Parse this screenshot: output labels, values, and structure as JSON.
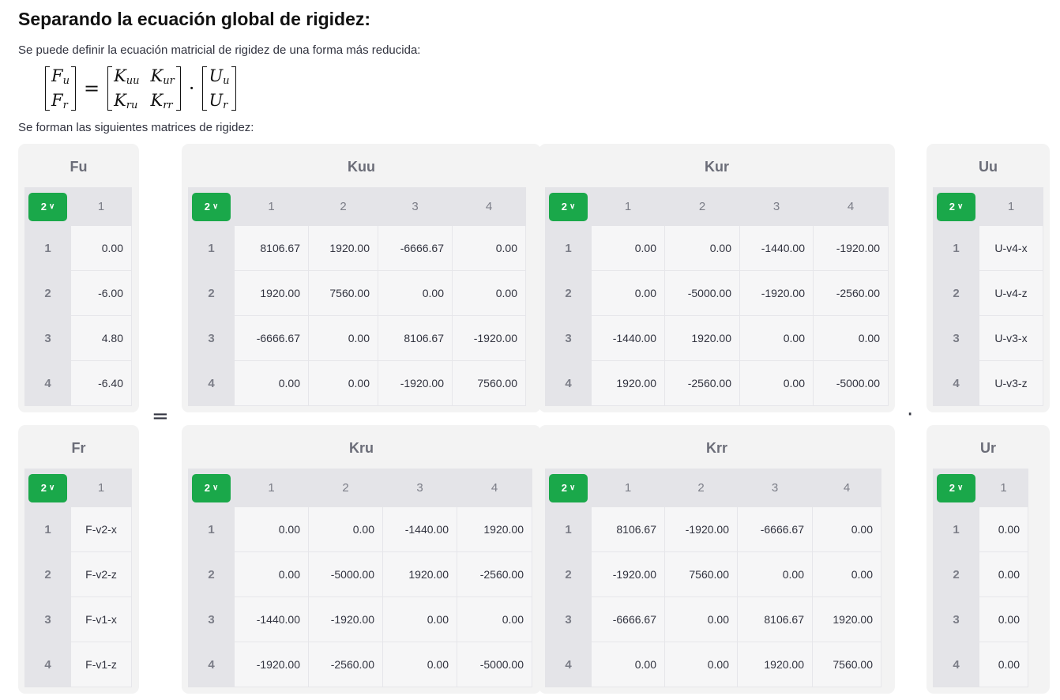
{
  "heading": "Separando la ecuación global de rigidez:",
  "intro": "Se puede definir la ecuación matricial de rigidez de una forma más reducida:",
  "equation": {
    "F": [
      {
        "base": "F",
        "sub": "u"
      },
      {
        "base": "F",
        "sub": "r"
      }
    ],
    "K": [
      [
        {
          "base": "K",
          "sub": "uu"
        },
        {
          "base": "K",
          "sub": "ur"
        }
      ],
      [
        {
          "base": "K",
          "sub": "ru"
        },
        {
          "base": "K",
          "sub": "rr"
        }
      ]
    ],
    "U": [
      {
        "base": "U",
        "sub": "u"
      },
      {
        "base": "U",
        "sub": "r"
      }
    ],
    "equals": "=",
    "dot": "·"
  },
  "subtitle": "Se forman las siguientes matrices de rigidez:",
  "equals_symbol": "=",
  "dot_symbol": "·",
  "dropdown_value": "2",
  "cards": {
    "Fu": {
      "title": "Fu",
      "cols": [
        "1"
      ],
      "rows": [
        "1",
        "2",
        "3",
        "4"
      ],
      "cells": [
        [
          "0.00"
        ],
        [
          "-6.00"
        ],
        [
          "4.80"
        ],
        [
          "-6.40"
        ]
      ]
    },
    "Kuu": {
      "title": "Kuu",
      "cols": [
        "1",
        "2",
        "3",
        "4"
      ],
      "rows": [
        "1",
        "2",
        "3",
        "4"
      ],
      "cells": [
        [
          "8106.67",
          "1920.00",
          "-6666.67",
          "0.00"
        ],
        [
          "1920.00",
          "7560.00",
          "0.00",
          "0.00"
        ],
        [
          "-6666.67",
          "0.00",
          "8106.67",
          "-1920.00"
        ],
        [
          "0.00",
          "0.00",
          "-1920.00",
          "7560.00"
        ]
      ]
    },
    "Kur": {
      "title": "Kur",
      "cols": [
        "1",
        "2",
        "3",
        "4"
      ],
      "rows": [
        "1",
        "2",
        "3",
        "4"
      ],
      "cells": [
        [
          "0.00",
          "0.00",
          "-1440.00",
          "-1920.00"
        ],
        [
          "0.00",
          "-5000.00",
          "-1920.00",
          "-2560.00"
        ],
        [
          "-1440.00",
          "1920.00",
          "0.00",
          "0.00"
        ],
        [
          "1920.00",
          "-2560.00",
          "0.00",
          "-5000.00"
        ]
      ]
    },
    "Uu": {
      "title": "Uu",
      "cols": [
        "1"
      ],
      "rows": [
        "1",
        "2",
        "3",
        "4"
      ],
      "cells": [
        [
          "U-v4-x"
        ],
        [
          "U-v4-z"
        ],
        [
          "U-v3-x"
        ],
        [
          "U-v3-z"
        ]
      ]
    },
    "Fr": {
      "title": "Fr",
      "cols": [
        "1"
      ],
      "rows": [
        "1",
        "2",
        "3",
        "4"
      ],
      "cells": [
        [
          "F-v2-x"
        ],
        [
          "F-v2-z"
        ],
        [
          "F-v1-x"
        ],
        [
          "F-v1-z"
        ]
      ]
    },
    "Kru": {
      "title": "Kru",
      "cols": [
        "1",
        "2",
        "3",
        "4"
      ],
      "rows": [
        "1",
        "2",
        "3",
        "4"
      ],
      "cells": [
        [
          "0.00",
          "0.00",
          "-1440.00",
          "1920.00"
        ],
        [
          "0.00",
          "-5000.00",
          "1920.00",
          "-2560.00"
        ],
        [
          "-1440.00",
          "-1920.00",
          "0.00",
          "0.00"
        ],
        [
          "-1920.00",
          "-2560.00",
          "0.00",
          "-5000.00"
        ]
      ]
    },
    "Krr": {
      "title": "Krr",
      "cols": [
        "1",
        "2",
        "3",
        "4"
      ],
      "rows": [
        "1",
        "2",
        "3",
        "4"
      ],
      "cells": [
        [
          "8106.67",
          "-1920.00",
          "-6666.67",
          "0.00"
        ],
        [
          "-1920.00",
          "7560.00",
          "0.00",
          "0.00"
        ],
        [
          "-6666.67",
          "0.00",
          "8106.67",
          "1920.00"
        ],
        [
          "0.00",
          "0.00",
          "1920.00",
          "7560.00"
        ]
      ]
    },
    "Ur": {
      "title": "Ur",
      "cols": [
        "1"
      ],
      "rows": [
        "1",
        "2",
        "3",
        "4"
      ],
      "cells": [
        [
          "0.00"
        ],
        [
          "0.00"
        ],
        [
          "0.00"
        ],
        [
          "0.00"
        ]
      ]
    }
  }
}
